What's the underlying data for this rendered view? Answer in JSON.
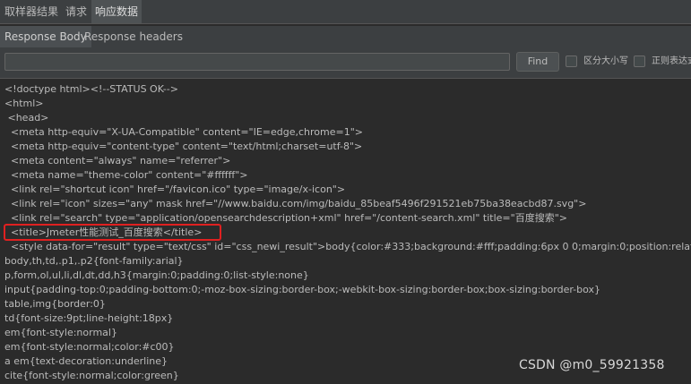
{
  "tabs": {
    "top": [
      "取样器结果",
      "请求",
      "响应数据"
    ],
    "sub": [
      "Response Body",
      "Response headers"
    ]
  },
  "search": {
    "value": "",
    "find_label": "Find",
    "case_sensitive_label": "区分大小写",
    "regex_label": "正则表达式"
  },
  "body_lines": [
    "<!doctype html><!--STATUS OK-->",
    "<html>",
    " <head>",
    "  <meta http-equiv=\"X-UA-Compatible\" content=\"IE=edge,chrome=1\">",
    "  <meta http-equiv=\"content-type\" content=\"text/html;charset=utf-8\">",
    "  <meta content=\"always\" name=\"referrer\">",
    "  <meta name=\"theme-color\" content=\"#ffffff\">",
    "  <link rel=\"shortcut icon\" href=\"/favicon.ico\" type=\"image/x-icon\">",
    "  <link rel=\"icon\" sizes=\"any\" mask href=\"//www.baidu.com/img/baidu_85beaf5496f291521eb75ba38eacbd87.svg\">",
    "  <link rel=\"search\" type=\"application/opensearchdescription+xml\" href=\"/content-search.xml\" title=\"百度搜索\">",
    "  <title>Jmeter性能测试_百度搜索</title>",
    "  <style data-for=\"result\" type=\"text/css\" id=\"css_newi_result\">body{color:#333;background:#fff;padding:6px 0 0;margin:0;position:relative}",
    "body,th,td,.p1,.p2{font-family:arial}",
    "p,form,ol,ul,li,dl,dt,dd,h3{margin:0;padding:0;list-style:none}",
    "input{padding-top:0;padding-bottom:0;-moz-box-sizing:border-box;-webkit-box-sizing:border-box;box-sizing:border-box}",
    "table,img{border:0}",
    "td{font-size:9pt;line-height:18px}",
    "em{font-style:normal}",
    "em{font-style:normal;color:#c00}",
    "a em{text-decoration:underline}",
    "cite{font-style:normal;color:green}"
  ],
  "watermark": "CSDN @m0_59921358",
  "colors": {
    "background": "#2b2b2b",
    "panel": "#3c3f41",
    "highlight_border": "#e02020"
  }
}
